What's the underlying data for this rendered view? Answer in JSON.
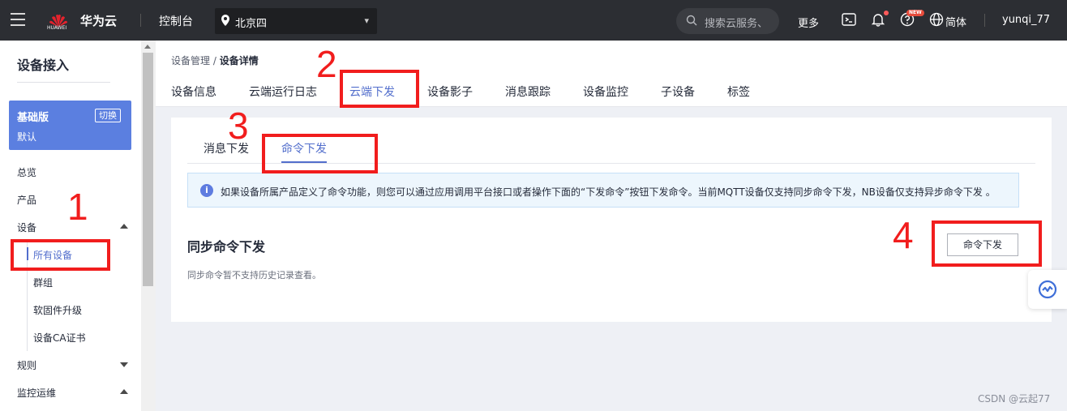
{
  "topbar": {
    "logo_sub": "HUAWEI",
    "brand": "华为云",
    "console": "控制台",
    "region": "北京四",
    "search_placeholder": "搜索云服务、",
    "more": "更多",
    "new_badge": "NEW",
    "lang": "简体",
    "user": "yunqi_77"
  },
  "sidebar": {
    "title": "设备接入",
    "edition": {
      "name": "基础版",
      "switch": "切换",
      "default": "默认"
    },
    "items": [
      "总览",
      "产品",
      "设备",
      "规则",
      "监控运维"
    ],
    "sub_items": [
      "所有设备",
      "群组",
      "软固件升级",
      "设备CA证书"
    ]
  },
  "breadcrumb": {
    "parent": "设备管理",
    "sep": " / ",
    "current": "设备详情"
  },
  "tabs": [
    "设备信息",
    "云端运行日志",
    "云端下发",
    "设备影子",
    "消息跟踪",
    "设备监控",
    "子设备",
    "标签"
  ],
  "subtabs": [
    "消息下发",
    "命令下发"
  ],
  "info_text": "如果设备所属产品定义了命令功能，则您可以通过应用调用平台接口或者操作下面的“下发命令”按钮下发命令。当前MQTT设备仅支持同步命令下发，NB设备仅支持异步命令下发 。",
  "section": {
    "title": "同步命令下发",
    "desc": "同步命令暂不支持历史记录查看。",
    "button": "命令下发"
  },
  "annotations": [
    "1",
    "2",
    "3",
    "4"
  ],
  "watermark": "CSDN @云起77",
  "colors": {
    "accent": "#526ecc",
    "annotation": "#f11d1d",
    "topbar": "#2c2e33"
  }
}
